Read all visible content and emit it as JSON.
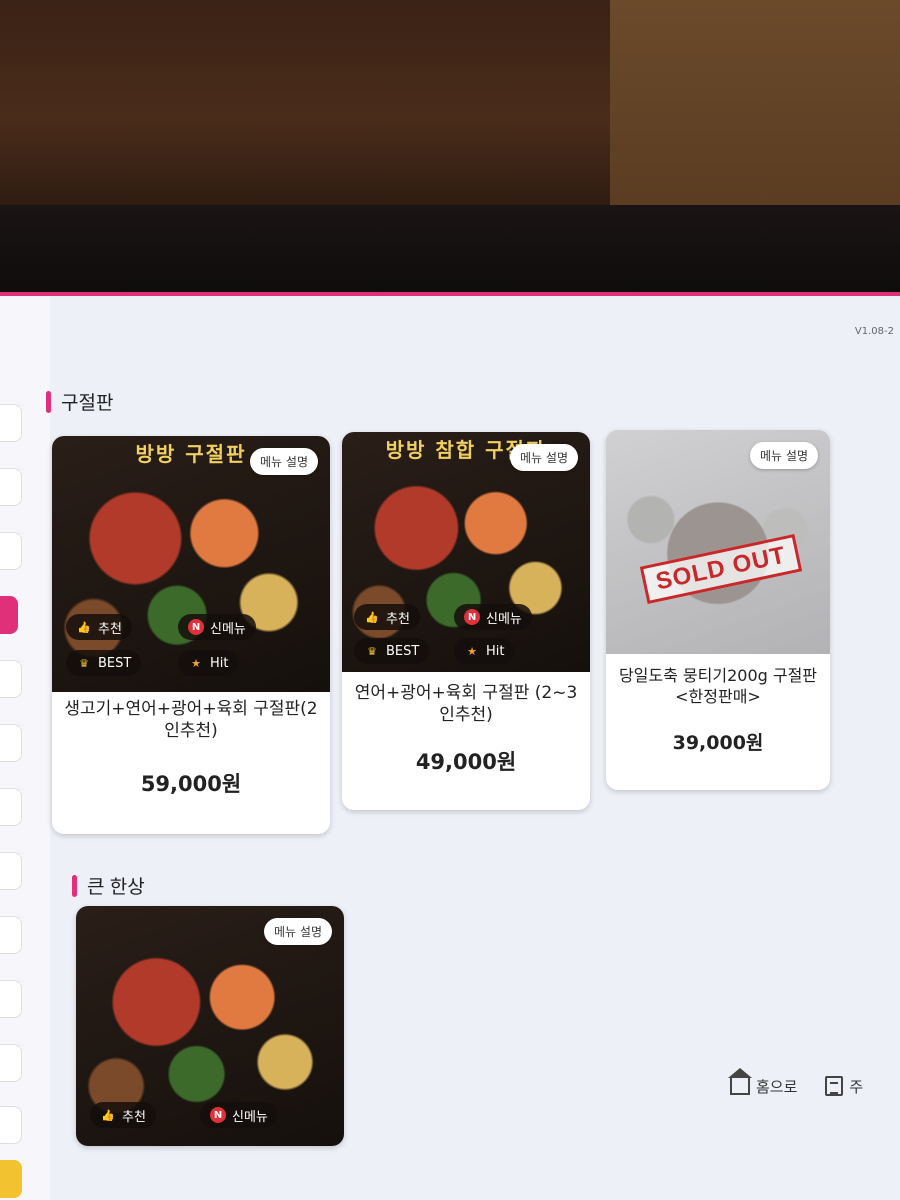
{
  "app": {
    "version": "V1.08-2"
  },
  "sections": [
    {
      "title": "구절판",
      "items": [
        {
          "headline": "방방 구절판",
          "desc_button": "메뉴 설명",
          "badges": [
            "추천",
            "신메뉴",
            "BEST",
            "Hit"
          ],
          "name": "생고기+연어+광어+육회 구절판(2인추천)",
          "price": "59,000원",
          "sold_out": false
        },
        {
          "headline": "방방 참합 구절판",
          "desc_button": "메뉴 설명",
          "badges": [
            "추천",
            "신메뉴",
            "BEST",
            "Hit"
          ],
          "name": "연어+광어+육회 구절판 (2~3인추천)",
          "price": "49,000원",
          "sold_out": false
        },
        {
          "headline": "",
          "desc_button": "메뉴 설명",
          "badges": [],
          "name": "당일도축 뭉티기200g 구절판<한정판매>",
          "price": "39,000원",
          "sold_out": true,
          "sold_out_label": "SOLD OUT"
        }
      ]
    },
    {
      "title": "큰 한상",
      "items": [
        {
          "desc_button": "메뉴 설명",
          "badges": [
            "추천",
            "신메뉴"
          ]
        }
      ]
    }
  ],
  "bottom_nav": {
    "home_label": "홈으로",
    "order_label": "주"
  },
  "colors": {
    "accent": "#e0307a",
    "soldout": "#c8282a"
  }
}
